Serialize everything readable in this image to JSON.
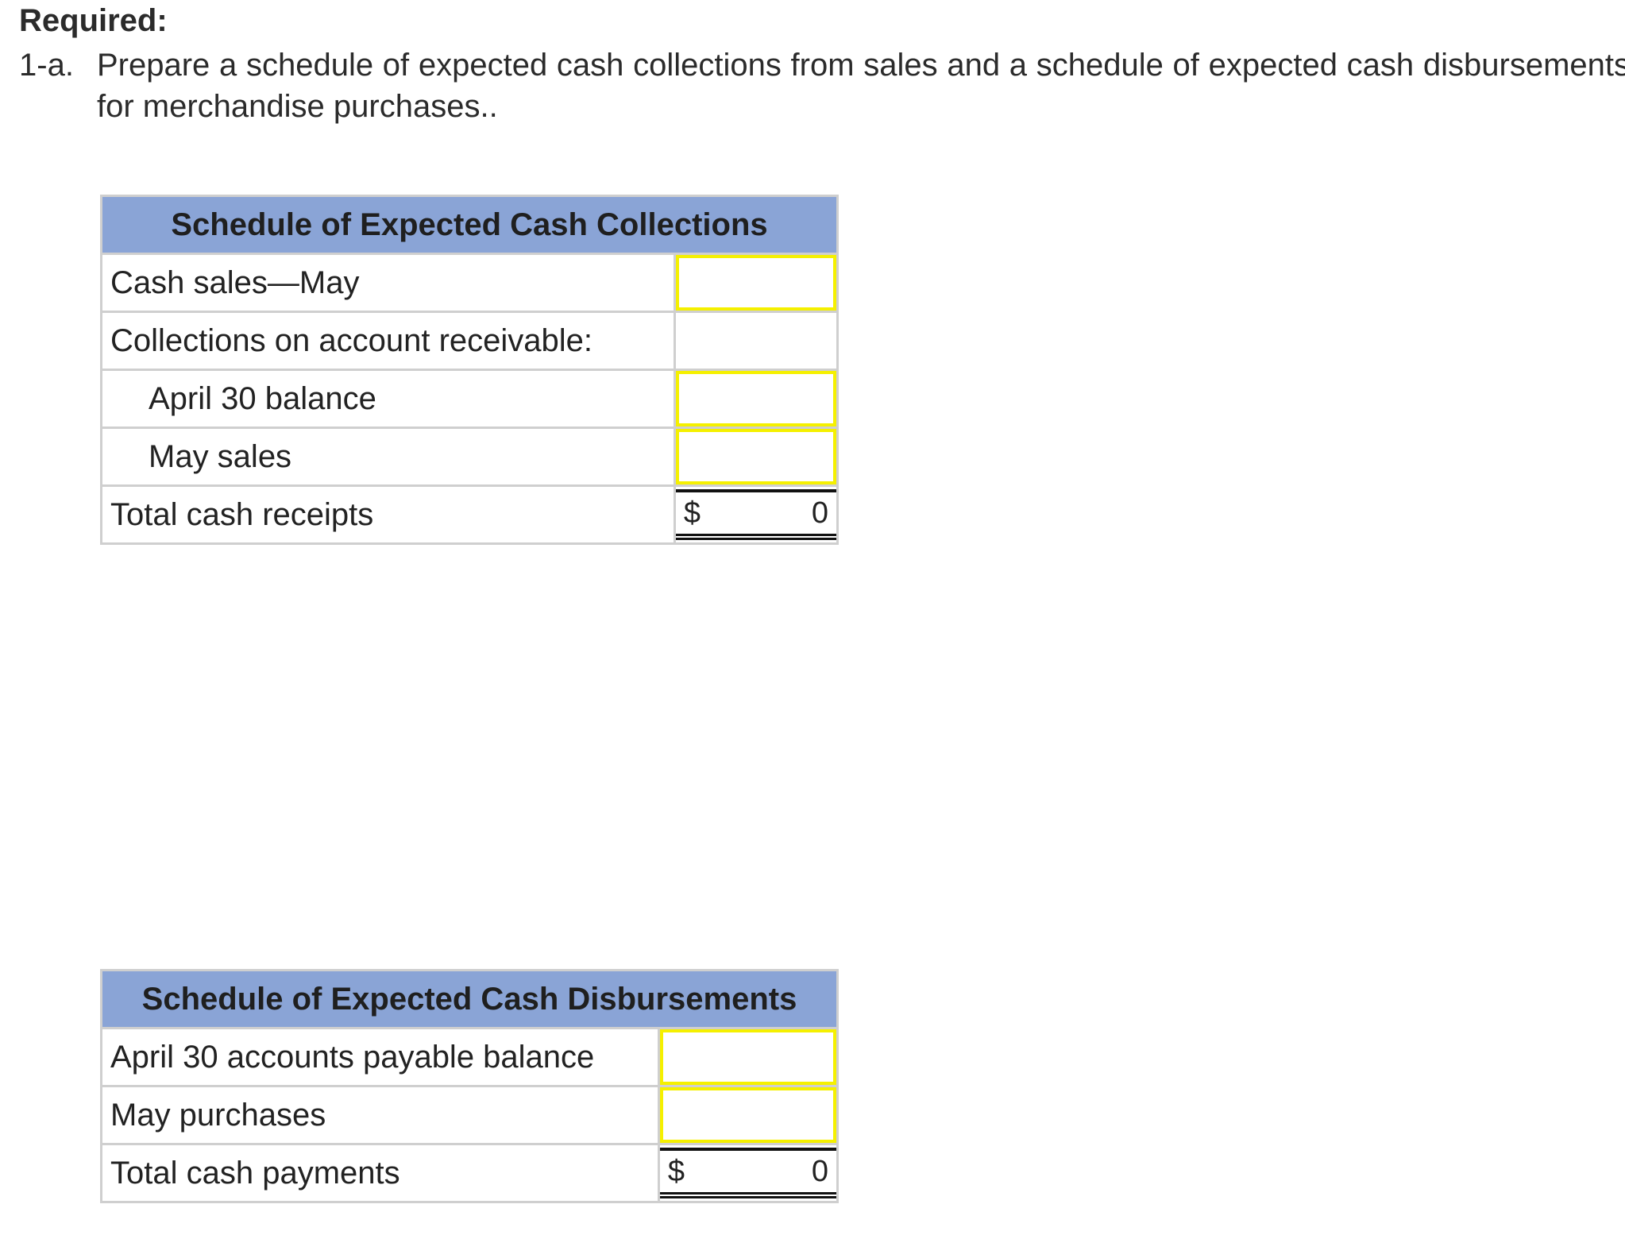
{
  "required_label": "Required:",
  "instruction": {
    "number": "1-a.",
    "text": "Prepare a schedule of expected cash collections from sales and a schedule of expected cash disbursements for merchandise purchases.."
  },
  "collections": {
    "title": "Schedule of Expected Cash Collections",
    "rows": [
      {
        "label": "Cash sales—May",
        "value": "",
        "input": true
      },
      {
        "label": "Collections on account receivable:",
        "value": "",
        "input": false
      },
      {
        "label": "April 30 balance",
        "value": "",
        "input": true
      },
      {
        "label": "May sales",
        "value": "",
        "input": true
      }
    ],
    "total": {
      "label": "Total cash receipts",
      "currency": "$",
      "value": "0"
    }
  },
  "disbursements": {
    "title": "Schedule of Expected Cash Disbursements",
    "rows": [
      {
        "label": "April 30 accounts payable balance",
        "value": "",
        "input": true
      },
      {
        "label": "May purchases",
        "value": "",
        "input": true
      }
    ],
    "total": {
      "label": "Total cash payments",
      "currency": "$",
      "value": "0"
    }
  },
  "colors": {
    "header_fill": "#8aa4d6",
    "input_border": "#f5f000",
    "grid_border": "#cfcfcf"
  }
}
